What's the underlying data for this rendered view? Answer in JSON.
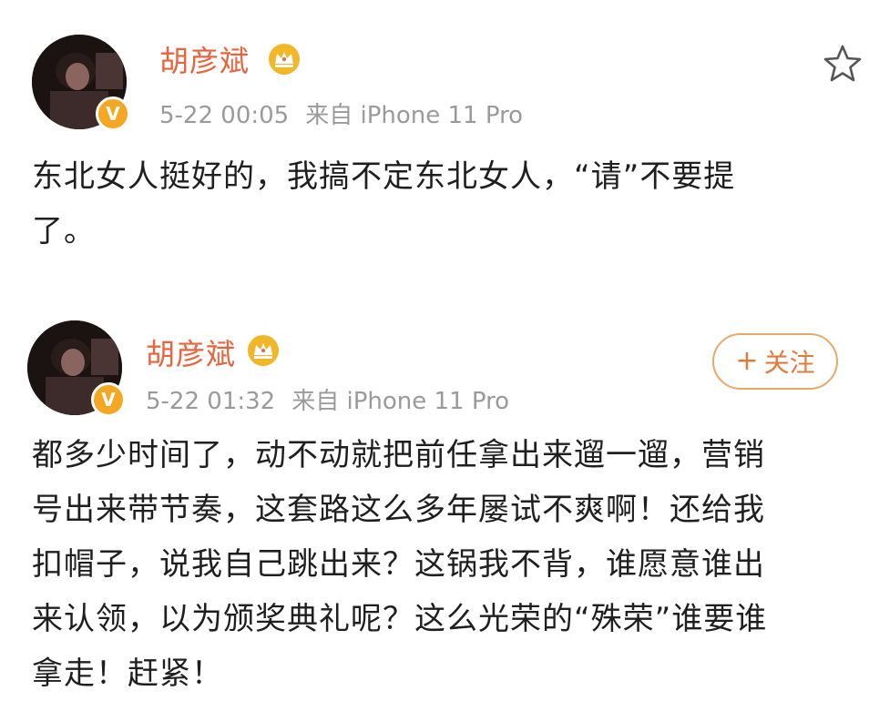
{
  "posts": [
    {
      "username": "胡彦斌",
      "date": "5-22 00:05",
      "source": "来自 iPhone 11 Pro",
      "text": "东北女人挺好的，我搞不定东北女人，“请”不要提了。",
      "lines": [
        "东北女人挺好的，我搞不定东北女人，“请”不要提",
        "了。"
      ]
    },
    {
      "username": "胡彦斌",
      "date": "5-22 01:32",
      "source": "来自 iPhone 11 Pro",
      "follow_label": "关注",
      "follow_prefix": "+",
      "lines": [
        "都多少时间了，动不动就把前任拿出来遛一遛，营销",
        "号出来带节奏，这套路这么多年屡试不爽啊！还给我",
        "扣帽子，说我自己跳出来？这锅我不背，谁愿意谁出",
        "来认领，以为颁奖典礼呢？这么光荣的“殊荣”谁要谁",
        "拿走！赶紧！"
      ]
    }
  ],
  "icons": {
    "star": "star-outline-icon",
    "crown": "crown-icon",
    "verified": "verified-v-icon"
  },
  "colors": {
    "username": "#e8643c",
    "meta": "#9a9a9a",
    "follow": "#e07b3a",
    "verified": "#f5a623",
    "crown": "#f2b728"
  },
  "badge_letter": "V"
}
